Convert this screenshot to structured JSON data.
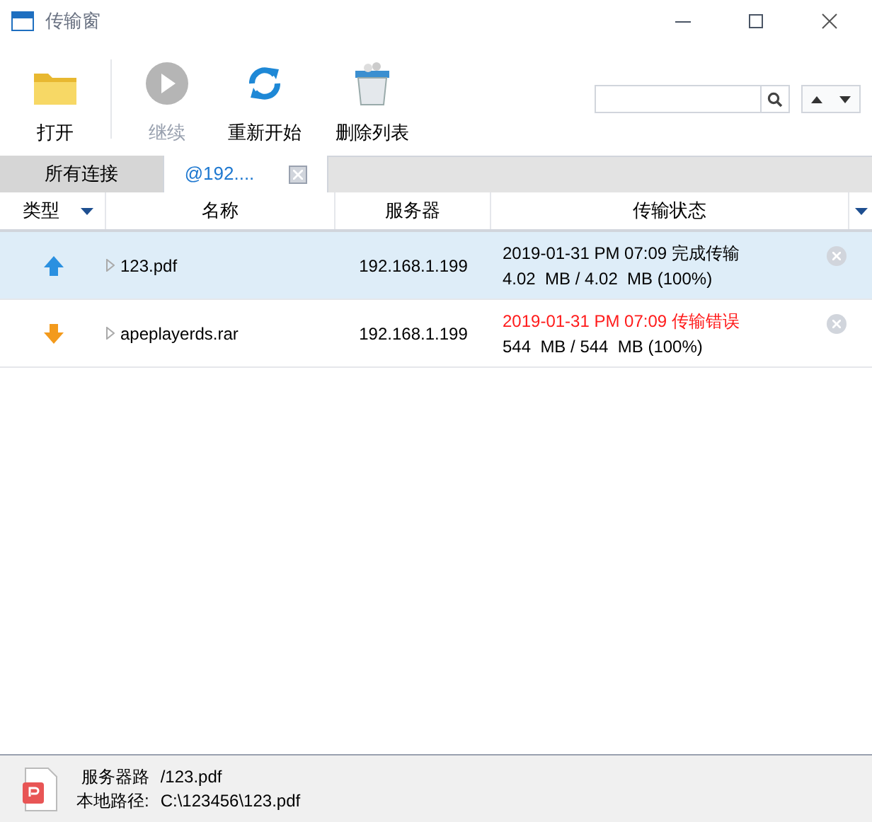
{
  "window": {
    "title": "传输窗"
  },
  "toolbar": [
    {
      "label": "打开",
      "kind": "folder",
      "disabled": false
    },
    {
      "label": "继续",
      "kind": "play",
      "disabled": true
    },
    {
      "label": "重新开始",
      "kind": "refresh",
      "disabled": false
    },
    {
      "label": "删除列表",
      "kind": "trash",
      "disabled": false
    }
  ],
  "tabs": [
    {
      "label": "所有连接",
      "selected": false,
      "closable": false
    },
    {
      "label": "@192....",
      "selected": true,
      "closable": true
    }
  ],
  "table": {
    "columns": [
      "类型",
      "名称",
      "服务器",
      "传输状态"
    ],
    "rows": [
      {
        "kind": "up",
        "name": "123.pdf",
        "server": "192.168.1.199",
        "time": "2019-01-31 PM 07:09",
        "status": "完成传输",
        "error": false,
        "size": "4.02  MB / 4.02  MB (100%)",
        "selected": true
      },
      {
        "kind": "down",
        "name": "apeplayerds.rar",
        "server": "192.168.1.199",
        "time": "2019-01-31 PM 07:09",
        "status": "传输错误",
        "error": true,
        "size": "544  MB / 544  MB (100%)",
        "selected": false
      }
    ]
  },
  "details": {
    "server_label": "服务器路",
    "server_path": "/123.pdf",
    "local_label": "本地路径:",
    "local_path": "C:\\123456\\123.pdf"
  }
}
